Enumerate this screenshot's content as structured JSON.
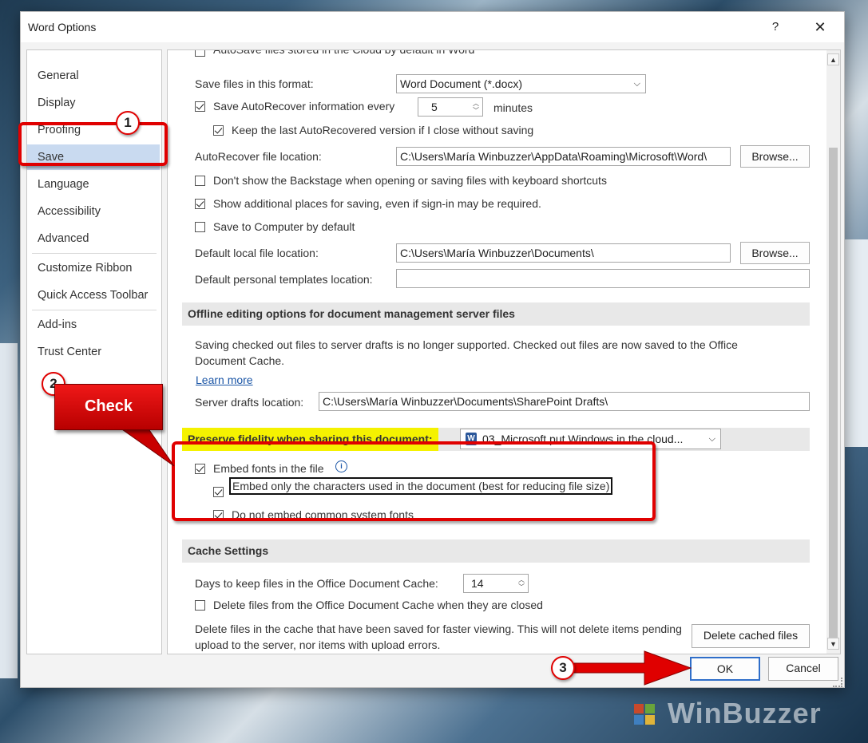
{
  "window": {
    "title": "Word Options",
    "help": "?",
    "close": "✕"
  },
  "nav": {
    "items": [
      {
        "label": "General"
      },
      {
        "label": "Display"
      },
      {
        "label": "Proofing"
      },
      {
        "label": "Save",
        "selected": true
      },
      {
        "label": "Language"
      },
      {
        "label": "Accessibility"
      },
      {
        "label": "Advanced"
      },
      {
        "label": "Customize Ribbon"
      },
      {
        "label": "Quick Access Toolbar"
      },
      {
        "label": "Add-ins"
      },
      {
        "label": "Trust Center"
      }
    ]
  },
  "save": {
    "autosave_partial": "AutoSave files stored in the Cloud by default in Word",
    "format_label": "Save files in this format:",
    "format_value": "Word Document (*.docx)",
    "autorecover_label": "Save AutoRecover information every",
    "autorecover_value": "5",
    "minutes": "minutes",
    "keep_last": "Keep the last AutoRecovered version if I close without saving",
    "ar_location_label": "AutoRecover file location:",
    "ar_location_value": "C:\\Users\\María Winbuzzer\\AppData\\Roaming\\Microsoft\\Word\\",
    "browse": "Browse...",
    "dont_show_backstage": "Don't show the Backstage when opening or saving files with keyboard shortcuts",
    "show_additional": "Show additional places for saving, even if sign-in may be required.",
    "save_to_computer": "Save to Computer by default",
    "default_local_label": "Default local file location:",
    "default_local_value": "C:\\Users\\María Winbuzzer\\Documents\\",
    "default_templates_label": "Default personal templates location:",
    "default_templates_value": ""
  },
  "offline": {
    "header": "Offline editing options for document management server files",
    "desc": "Saving checked out files to server drafts is no longer supported. Checked out files are now saved to the Office Document Cache.",
    "learn_more": "Learn more",
    "drafts_label": "Server drafts location:",
    "drafts_value": "C:\\Users\\María Winbuzzer\\Documents\\SharePoint Drafts\\"
  },
  "fidelity": {
    "header": "Preserve fidelity when sharing this document:",
    "doc_value": "03_Microsoft put Windows in the cloud...",
    "embed_fonts": "Embed fonts in the file",
    "embed_only": "Embed only the characters used in the document (best for reducing file size)",
    "no_common": "Do not embed common system fonts"
  },
  "cache": {
    "header": "Cache Settings",
    "days_label": "Days to keep files in the Office Document Cache:",
    "days_value": "14",
    "delete_closed": "Delete files from the Office Document Cache when they are closed",
    "delete_desc": "Delete files in the cache that have been saved for faster viewing. This will not delete items pending upload to the server, nor items with upload errors.",
    "delete_button": "Delete cached files"
  },
  "footer": {
    "ok": "OK",
    "cancel": "Cancel"
  },
  "annotations": {
    "step1": "1",
    "step2": "2",
    "step3": "3",
    "callout": "Check",
    "accent": "#e00000",
    "highlight": "#f5f200"
  },
  "watermark": "WinBuzzer"
}
